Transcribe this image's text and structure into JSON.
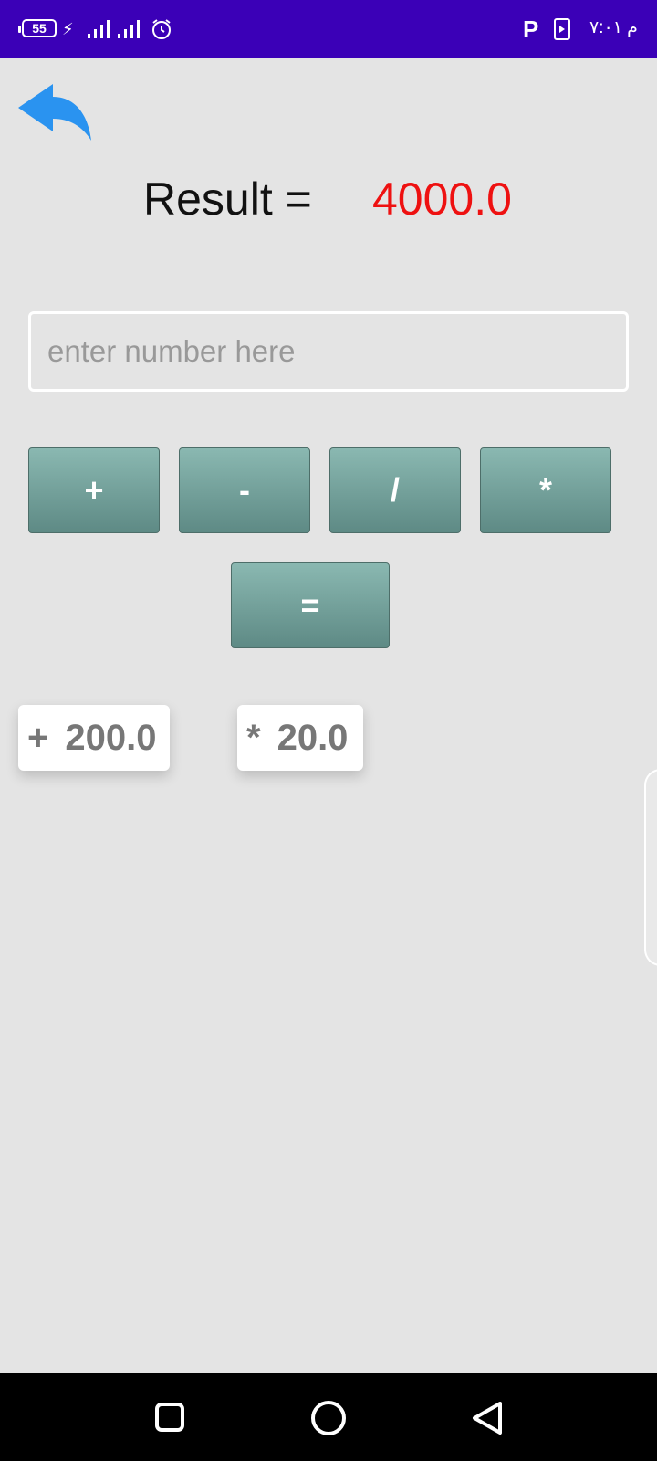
{
  "status_bar": {
    "battery": "55",
    "clock": "م ٧:٠١"
  },
  "result": {
    "label": "Result =",
    "value": "4000.0"
  },
  "input": {
    "placeholder": "enter number here",
    "value": ""
  },
  "operators": {
    "plus": "+",
    "minus": "-",
    "divide": "/",
    "multiply": "*",
    "equals": "="
  },
  "history": [
    {
      "op": "+",
      "value": "200.0"
    },
    {
      "op": "*",
      "value": "20.0"
    }
  ],
  "icons": {
    "back": "back-arrow-icon",
    "nav_recent": "recent-apps-icon",
    "nav_home": "home-icon",
    "nav_back": "nav-back-icon"
  },
  "colors": {
    "status_bar": "#3b00b7",
    "result_value": "#ee1111",
    "back_arrow": "#2a93f0",
    "button": "#6f9b95"
  }
}
